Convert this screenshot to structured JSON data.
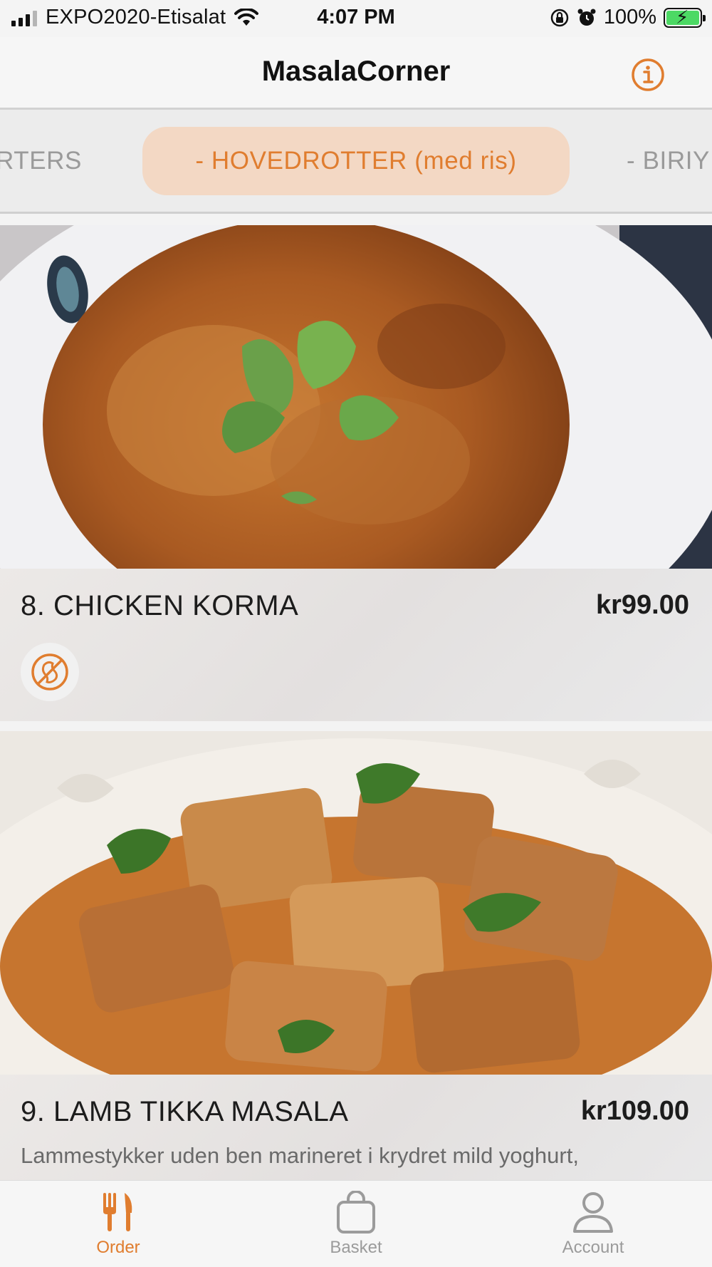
{
  "status_bar": {
    "carrier": "EXPO2020-Etisalat",
    "time": "4:07 PM",
    "battery": "100%"
  },
  "nav": {
    "title": "MasalaCorner"
  },
  "categories": {
    "prev": "RTERS",
    "active": "- HOVEDROTTER (med ris)",
    "next": "- BIRIY"
  },
  "menu_items": [
    {
      "name": "8. CHICKEN KORMA",
      "price": "kr99.00",
      "allergen_icon": "no-peanut-icon"
    },
    {
      "name": "9. LAMB TIKKA MASALA",
      "price": "kr109.00",
      "description": "Lammestykker uden ben marineret i krydret mild yoghurt,"
    }
  ],
  "tab_bar": {
    "order": "Order",
    "basket": "Basket",
    "account": "Account"
  },
  "colors": {
    "accent": "#e07d2f",
    "active_tab_bg": "#f3d8c4",
    "inactive": "#9b9b9b"
  }
}
